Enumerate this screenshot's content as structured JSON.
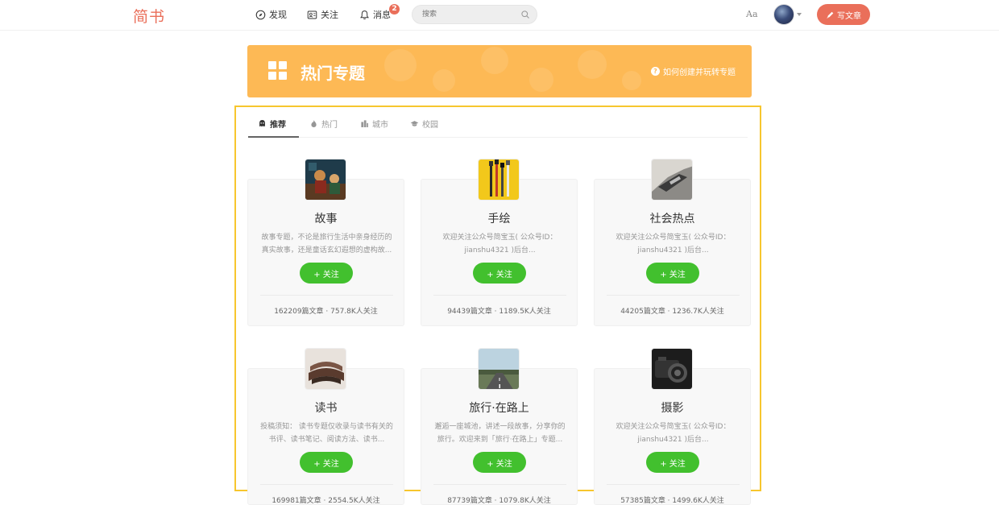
{
  "header": {
    "logo": "简书",
    "nav": [
      {
        "label": "发现",
        "icon": "compass-icon"
      },
      {
        "label": "关注",
        "icon": "follow-icon"
      },
      {
        "label": "消息",
        "icon": "bell-icon",
        "badge": "2"
      }
    ],
    "search": {
      "placeholder": "搜索",
      "icon": "search-icon"
    },
    "font_toggle": "Aa",
    "write_label": "写文章"
  },
  "banner": {
    "title": "热门专题",
    "help_link": "如何创建并玩转专题",
    "color": "#fdb955"
  },
  "tabs": [
    {
      "label": "推荐",
      "icon": "recommend-icon",
      "active": true
    },
    {
      "label": "热门",
      "icon": "fire-icon",
      "active": false
    },
    {
      "label": "城市",
      "icon": "city-icon",
      "active": false
    },
    {
      "label": "校园",
      "icon": "graduation-cap-icon",
      "active": false
    }
  ],
  "collections": [
    {
      "title": "故事",
      "desc": "故事专题，不论是旅行生活中亲身经历的真实故事，还是童话玄幻遐想的虚构故...",
      "follow": "+ 关注",
      "meta": "162209篇文章 · 757.8K人关注"
    },
    {
      "title": "手绘",
      "desc": "欢迎关注公众号简宝玉( 公众号ID：jianshu4321 )后台...",
      "follow": "+ 关注",
      "meta": "94439篇文章 · 1189.5K人关注"
    },
    {
      "title": "社会热点",
      "desc": "欢迎关注公众号简宝玉( 公众号ID：jianshu4321 )后台...",
      "follow": "+ 关注",
      "meta": "44205篇文章 · 1236.7K人关注"
    },
    {
      "title": "读书",
      "desc": "投稿须知： 读书专题仅收录与读书有关的书评、读书笔记、阅读方法、读书...",
      "follow": "+ 关注",
      "meta": "169981篇文章 · 2554.5K人关注"
    },
    {
      "title": "旅行·在路上",
      "desc": "邂逅一座城池，讲述一段故事，分享你的旅行。欢迎来到「旅行·在路上」专题...",
      "follow": "+ 关注",
      "meta": "87739篇文章 · 1079.8K人关注"
    },
    {
      "title": "摄影",
      "desc": "欢迎关注公众号简宝玉( 公众号ID：jianshu4321 )后台...",
      "follow": "+ 关注",
      "meta": "57385篇文章 · 1499.6K人关注"
    }
  ],
  "colors": {
    "accent": "#ea6f5a",
    "follow_green": "#42c02e",
    "highlight": "#f7c62e"
  }
}
